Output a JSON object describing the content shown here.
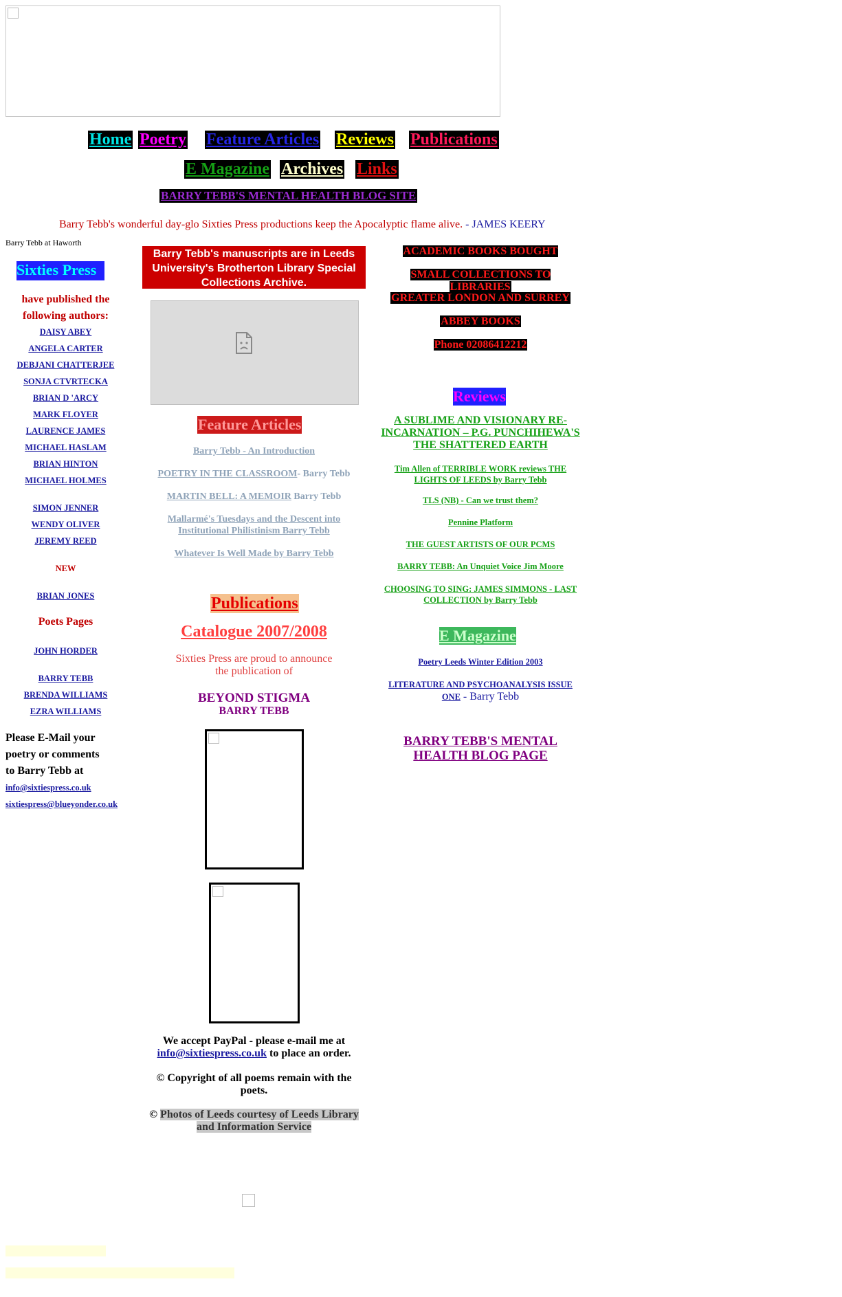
{
  "nav": {
    "home": "Home",
    "poetry": "Poetry",
    "feature_articles": "Feature Articles",
    "reviews": "Reviews",
    "publications": "Publications",
    "e_magazine": "E Magazine",
    "archives": "Archives",
    "links": "Links",
    "mental_health_blog": "BARRY TEBB'S MENTAL HEALTH BLOG SITE"
  },
  "quote": {
    "text": "Barry Tebb's wonderful day-glo Sixties Press productions keep the Apocalyptic flame alive. ",
    "author": "- JAMES KEERY"
  },
  "photo_caption": "Barry Tebb at Haworth",
  "left": {
    "title": "Sixties Press",
    "intro": "have published the following authors:",
    "authors": [
      "DAISY ABEY",
      "ANGELA CARTER",
      "DEBJANI CHATTERJEE",
      "SONJA CTVRTECKA",
      "BRIAN D 'ARCY",
      "MARK FLOYER",
      "LAURENCE JAMES",
      "MICHAEL HASLAM",
      "BRIAN HINTON",
      "MICHAEL HOLMES",
      "SIMON JENNER",
      "WENDY OLIVER",
      "JEREMY REED"
    ],
    "new_label": "NEW",
    "new_author": "BRIAN JONES",
    "poets_pages": "Poets Pages",
    "poets": [
      "JOHN HORDER",
      "BARRY TEBB",
      "BRENDA WILLIAMS",
      "EZRA WILLIAMS"
    ],
    "email_text": "Please E-Mail your poetry or comments to Barry Tebb at",
    "emails": [
      "info@sixtiespress.co.uk",
      "sixtiespress@blueyonder.co.uk"
    ]
  },
  "middle": {
    "manuscripts": "Barry Tebb's manuscripts are in Leeds University's Brotherton Library Special Collections Archive.",
    "feature_title": "Feature Articles",
    "features": [
      {
        "link": "Barry Tebb - An Introduction",
        "suffix": ""
      },
      {
        "link": "POETRY IN THE CLASSROOM",
        "suffix": "- Barry Tebb"
      },
      {
        "link": "MARTIN BELL: A MEMOIR",
        "suffix": " Barry Tebb"
      },
      {
        "link": "Mallarmé's Tuesdays and the Descent into Institutional Philistinism Barry Tebb",
        "suffix": ""
      },
      {
        "link": "Whatever Is Well Made by Barry Tebb",
        "suffix": ""
      }
    ],
    "publications_title": "Publications",
    "catalogue": "Catalogue 2007/2008",
    "proud": "Sixties Press are proud to announce the publication of",
    "book_title": "BEYOND STIGMA",
    "book_author": "BARRY TEBB",
    "paypal_before": "We accept PayPal - please e-mail me at ",
    "paypal_email": "info@sixtiespress.co.uk",
    "paypal_after": " to place an order.",
    "copyright_poems": "© Copyright of all poems remain with the poets.",
    "copyright_symbol": "© ",
    "copyright_photos": "Photos of Leeds courtesy of Leeds Library and Information Service"
  },
  "right": {
    "ads": [
      "ACADEMIC BOOKS BOUGHT",
      "SMALL COLLECTIONS TO LIBRARIES",
      "GREATER LONDON AND SURREY",
      "ABBEY BOOKS",
      "Phone 02086412212"
    ],
    "reviews_title": "Reviews",
    "reviews": [
      "A SUBLIME AND VISIONARY RE-INCARNATION – P.G. PUNCHIHEWA'S THE SHATTERED EARTH",
      "Tim Allen of TERRIBLE WORK reviews THE LIGHTS OF LEEDS by Barry Tebb",
      "TLS (NB) - Can we trust them?",
      "Pennine Platform",
      "THE GUEST ARTISTS OF OUR PCMS",
      "BARRY TEBB: An Unquiet Voice Jim Moore",
      "CHOOSING TO SING: JAMES SIMMONS - LAST COLLECTION by Barry Tebb"
    ],
    "emag_title": "E Magazine",
    "emag_items": [
      "Poetry Leeds Winter Edition 2003",
      "LITERATURE AND PSYCHOANALYSIS ISSUE ONE"
    ],
    "emag_suffix": " - Barry Tebb",
    "blog_page": "BARRY TEBB'S MENTAL HEALTH BLOG PAGE"
  },
  "colors": {
    "manuscripts_bg": "#cc0000",
    "ads_text": "#ff1a1a",
    "reviews_text": "#15a015",
    "authors_link": "#1a1aa0"
  }
}
